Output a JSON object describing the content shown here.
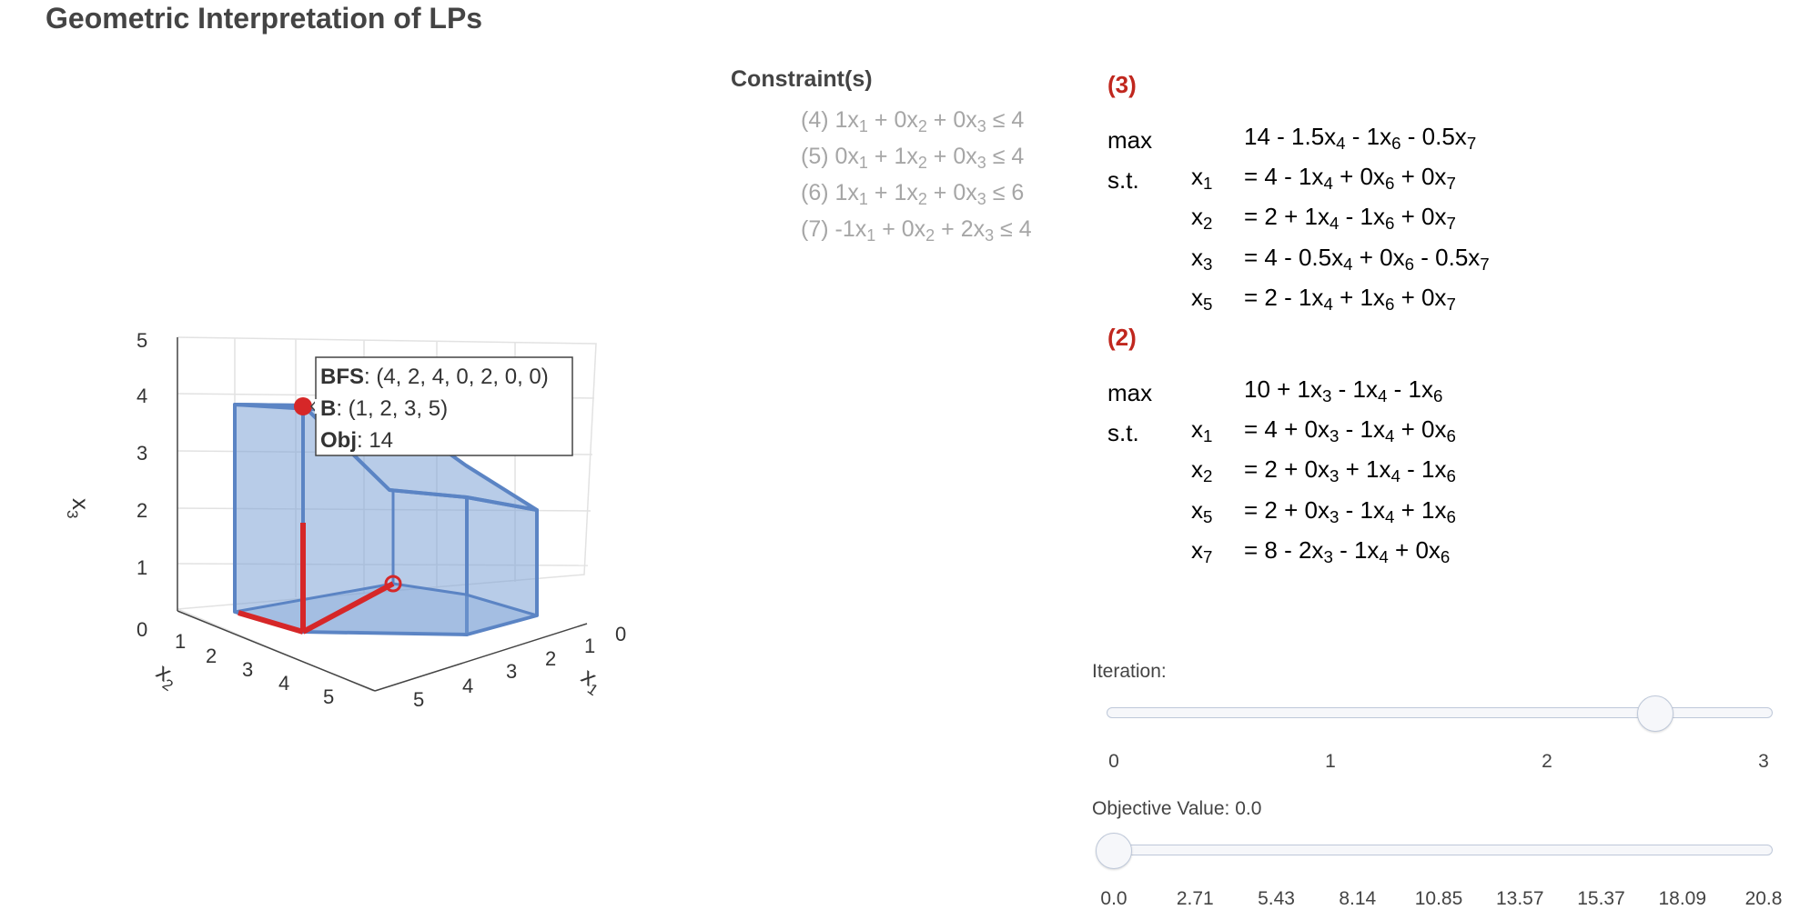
{
  "title": "Geometric Interpretation of LPs",
  "constraints": {
    "heading": "Constraint(s)",
    "items": [
      {
        "num": "(4)",
        "a": "1",
        "b": "0",
        "c": "0",
        "rhs": "4",
        "s1": " + ",
        "s2": " + "
      },
      {
        "num": "(5)",
        "a": "0",
        "b": "1",
        "c": "0",
        "rhs": "4",
        "s1": " + ",
        "s2": " + "
      },
      {
        "num": "(6)",
        "a": "1",
        "b": "1",
        "c": "0",
        "rhs": "6",
        "s1": " + ",
        "s2": " + "
      },
      {
        "num": "(7)",
        "a": "-1",
        "b": "0",
        "c": "2",
        "rhs": "4",
        "s1": " + ",
        "s2": " + "
      }
    ]
  },
  "tableaux": [
    {
      "label": "(3)",
      "max_label": "max",
      "st_label": "s.t.",
      "objective": [
        [
          "14 - 1.5x",
          ""
        ],
        [
          "4",
          " - 1x"
        ],
        [
          "6",
          " - 0.5x"
        ],
        [
          "7",
          ""
        ]
      ],
      "rows": [
        {
          "var": "1",
          "expr": [
            [
              "= 4 - 1x",
              ""
            ],
            [
              "4",
              " + 0x"
            ],
            [
              "6",
              " + 0x"
            ],
            [
              "7",
              ""
            ]
          ]
        },
        {
          "var": "2",
          "expr": [
            [
              "= 2 + 1x",
              ""
            ],
            [
              "4",
              " - 1x"
            ],
            [
              "6",
              " + 0x"
            ],
            [
              "7",
              ""
            ]
          ]
        },
        {
          "var": "3",
          "expr": [
            [
              "= 4 - 0.5x",
              ""
            ],
            [
              "4",
              " + 0x"
            ],
            [
              "6",
              " - 0.5x"
            ],
            [
              "7",
              ""
            ]
          ]
        },
        {
          "var": "5",
          "expr": [
            [
              "= 2 - 1x",
              ""
            ],
            [
              "4",
              " + 1x"
            ],
            [
              "6",
              " + 0x"
            ],
            [
              "7",
              ""
            ]
          ]
        }
      ]
    },
    {
      "label": "(2)",
      "max_label": "max",
      "st_label": "s.t.",
      "objective": [
        [
          "10 + 1x",
          ""
        ],
        [
          "3",
          " - 1x"
        ],
        [
          "4",
          " - 1x"
        ],
        [
          "6",
          ""
        ]
      ],
      "rows": [
        {
          "var": "1",
          "expr": [
            [
              "= 4 + 0x",
              ""
            ],
            [
              "3",
              " - 1x"
            ],
            [
              "4",
              " + 0x"
            ],
            [
              "6",
              ""
            ]
          ]
        },
        {
          "var": "2",
          "expr": [
            [
              "= 2 + 0x",
              ""
            ],
            [
              "3",
              " + 1x"
            ],
            [
              "4",
              " - 1x"
            ],
            [
              "6",
              ""
            ]
          ]
        },
        {
          "var": "5",
          "expr": [
            [
              "= 2 + 0x",
              ""
            ],
            [
              "3",
              " - 1x"
            ],
            [
              "4",
              " + 1x"
            ],
            [
              "6",
              ""
            ]
          ]
        },
        {
          "var": "7",
          "expr": [
            [
              "= 8 - 2x",
              ""
            ],
            [
              "3",
              " - 1x"
            ],
            [
              "4",
              " + 0x"
            ],
            [
              "6",
              ""
            ]
          ]
        }
      ]
    }
  ],
  "plot": {
    "x_axis_label": "x",
    "x_axis_sub": "1",
    "y_axis_label": "x",
    "y_axis_sub": "2",
    "z_axis_label": "x",
    "z_axis_sub": "3",
    "x_ticks": [
      "0",
      "1",
      "2",
      "3",
      "4",
      "5"
    ],
    "y_ticks": [
      "1",
      "2",
      "3",
      "4",
      "5"
    ],
    "z_ticks": [
      "0",
      "1",
      "2",
      "3",
      "4",
      "5"
    ],
    "polytope_color": "#7ea2d6",
    "edge_color": "#5b84c4",
    "path_color": "#d62728",
    "tooltip": {
      "bfs_label": "BFS",
      "bfs_value": ": (4, 2, 4, 0, 2, 0, 0)",
      "b_label": "B",
      "b_value": ": (1, 2, 3, 5)",
      "obj_label": "Obj",
      "obj_value": ": 14"
    }
  },
  "iteration_slider": {
    "label": "Iteration:",
    "ticks": [
      "0",
      "1",
      "2",
      "3"
    ],
    "value": 2.5
  },
  "objective_slider": {
    "label": "Objective Value: 0.0",
    "ticks": [
      "0.0",
      "2.71",
      "5.43",
      "8.14",
      "10.85",
      "13.57",
      "15.37",
      "18.09",
      "20.8"
    ],
    "value": 0.0
  }
}
